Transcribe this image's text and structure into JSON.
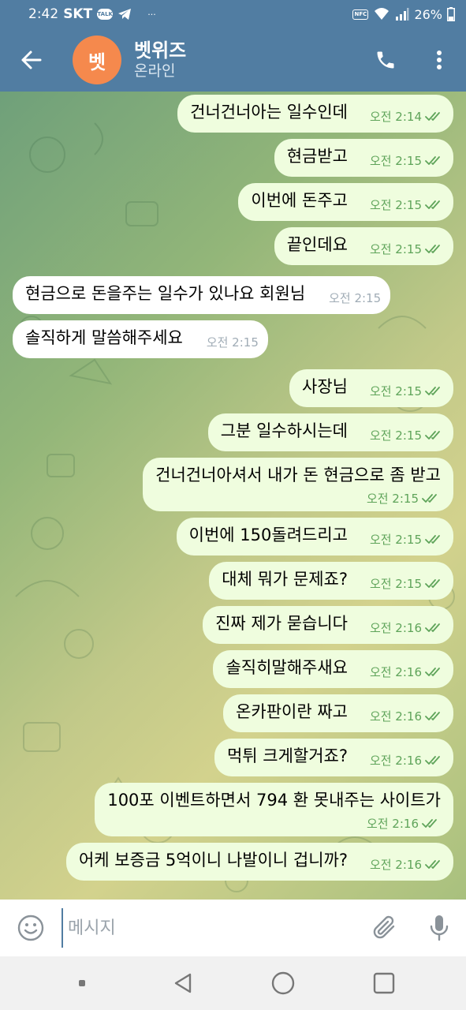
{
  "status_bar": {
    "time": "2:42",
    "carrier": "SKT",
    "talk_badge": "TALK",
    "more": "···",
    "nfc": "NFC",
    "battery": "26%"
  },
  "header": {
    "avatar_letter": "벳",
    "title": "벳위즈",
    "status": "온라인"
  },
  "messages": [
    {
      "dir": "out",
      "text": "건너건너아는 일수인데",
      "time": "오전 2:14",
      "read": true
    },
    {
      "dir": "out",
      "text": "현금받고",
      "time": "오전 2:15",
      "read": true
    },
    {
      "dir": "out",
      "text": "이번에 돈주고",
      "time": "오전 2:15",
      "read": true
    },
    {
      "dir": "out",
      "text": "끝인데요",
      "time": "오전 2:15",
      "read": true
    },
    {
      "dir": "in",
      "text": "현금으로 돈을주는 일수가 있나요 회원님",
      "time": "오전 2:15"
    },
    {
      "dir": "in",
      "text": "솔직하게 말씀해주세요",
      "time": "오전 2:15"
    },
    {
      "dir": "out",
      "text": "사장님",
      "time": "오전 2:15",
      "read": true
    },
    {
      "dir": "out",
      "text": "그분 일수하시는데",
      "time": "오전 2:15",
      "read": true
    },
    {
      "dir": "out",
      "text": "건너건너아셔서 내가 돈 현금으로 좀 받고",
      "time": "오전 2:15",
      "read": true
    },
    {
      "dir": "out",
      "text": "이번에 150돌려드리고",
      "time": "오전 2:15",
      "read": true
    },
    {
      "dir": "out",
      "text": "대체 뭐가 문제죠?",
      "time": "오전 2:15",
      "read": true
    },
    {
      "dir": "out",
      "text": "진짜 제가 묻습니다",
      "time": "오전 2:16",
      "read": true
    },
    {
      "dir": "out",
      "text": "솔직히말해주새요",
      "time": "오전 2:16",
      "read": true
    },
    {
      "dir": "out",
      "text": "온카판이란 짜고",
      "time": "오전 2:16",
      "read": true
    },
    {
      "dir": "out",
      "text": "먹튀 크게할거죠?",
      "time": "오전 2:16",
      "read": true
    },
    {
      "dir": "out",
      "text": "100포 이벤트하면서 794 환 못내주는 사이트가",
      "time": "오전 2:16",
      "read": true
    },
    {
      "dir": "out",
      "text": "어케 보증금 5억이니 나발이니 겁니까?",
      "time": "오전 2:16",
      "read": true
    }
  ],
  "input": {
    "placeholder": "메시지"
  },
  "icons": {
    "back": "back-arrow-icon",
    "call": "phone-icon",
    "menu": "more-vertical-icon",
    "emoji": "smile-icon",
    "attach": "paperclip-icon",
    "mic": "microphone-icon",
    "read": "double-check-icon"
  },
  "colors": {
    "header": "#517da2",
    "avatar": "#f5894d",
    "outgoing_bubble": "#effdde",
    "incoming_bubble": "#ffffff",
    "read_tick": "#5fa45a"
  }
}
